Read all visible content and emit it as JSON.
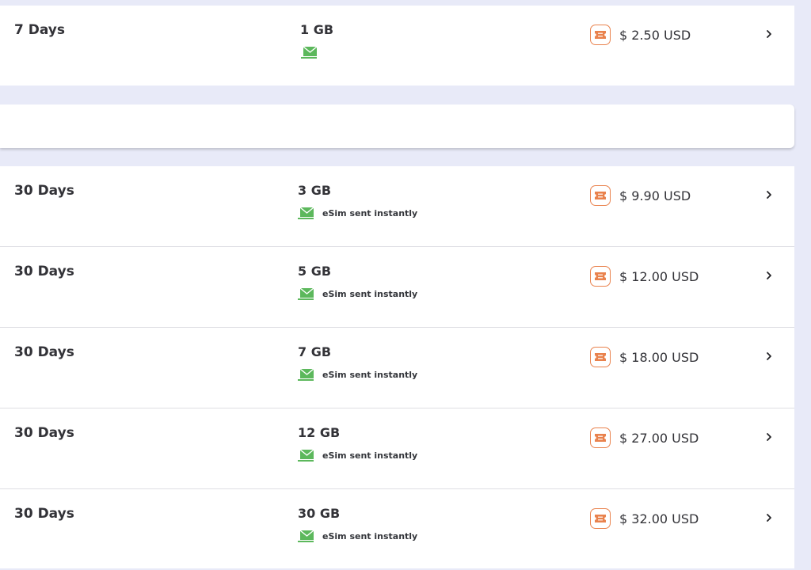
{
  "colors": {
    "background": "#e8eaf8",
    "card": "#ffffff",
    "accent_orange": "#e9824d",
    "accent_green": "#5cb85c"
  },
  "icons": {
    "delivery": "mail-send-icon",
    "price": "ticket-icon",
    "open": "chevron-right-icon"
  },
  "top_plan": {
    "duration": "7 Days",
    "data": "1 GB",
    "price": "$ 2.50 USD"
  },
  "plans": [
    {
      "duration": "30 Days",
      "data": "3 GB",
      "delivery": "eSim sent instantly",
      "price": "$ 9.90 USD"
    },
    {
      "duration": "30 Days",
      "data": "5 GB",
      "delivery": "eSim sent instantly",
      "price": "$ 12.00 USD"
    },
    {
      "duration": "30 Days",
      "data": "7 GB",
      "delivery": "eSim sent instantly",
      "price": "$ 18.00 USD"
    },
    {
      "duration": "30 Days",
      "data": "12 GB",
      "delivery": "eSim sent instantly",
      "price": "$ 27.00 USD"
    },
    {
      "duration": "30 Days",
      "data": "30 GB",
      "delivery": "eSim sent instantly",
      "price": "$ 32.00 USD"
    }
  ]
}
